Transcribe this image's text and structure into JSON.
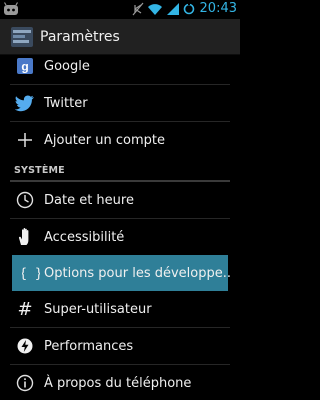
{
  "status_bar": {
    "time": "20:43",
    "icons": [
      "android-notification-icon",
      "silent-mode-icon",
      "wifi-icon",
      "signal-icon",
      "battery-icon"
    ]
  },
  "action_bar": {
    "title": "Paramètres",
    "icon": "settings-app-icon"
  },
  "sections": [
    {
      "items": [
        {
          "label": "Google",
          "icon": "google-icon"
        },
        {
          "label": "Twitter",
          "icon": "twitter-icon"
        },
        {
          "label": "Ajouter un compte",
          "icon": "plus-icon"
        }
      ]
    },
    {
      "header": "SYSTÈME",
      "items": [
        {
          "label": "Date et heure",
          "icon": "clock-icon"
        },
        {
          "label": "Accessibilité",
          "icon": "hand-icon"
        },
        {
          "label": "Options pour les développe..",
          "icon": "braces-icon",
          "selected": true
        },
        {
          "label": "Super-utilisateur",
          "icon": "hash-icon"
        },
        {
          "label": "Performances",
          "icon": "lightning-icon"
        },
        {
          "label": "À propos du téléphone",
          "icon": "info-icon"
        }
      ]
    }
  ],
  "colors": {
    "accent": "#33b5e5",
    "selected_row": "#2f7f98",
    "action_bar": "#212121"
  }
}
